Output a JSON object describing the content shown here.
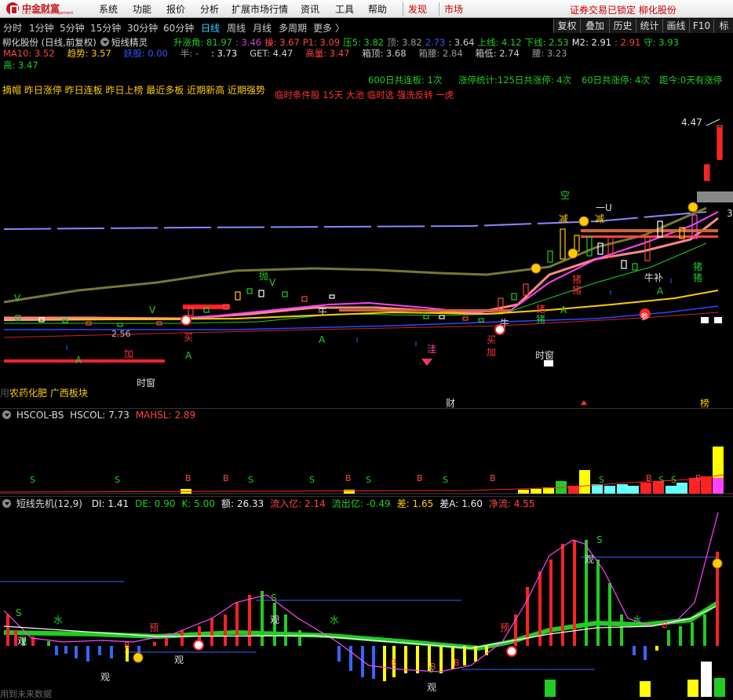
{
  "app": {
    "logo_cn": "中金财富",
    "logo_en": "CICC Wealth Management",
    "menu": [
      "系统",
      "功能",
      "报价",
      "分析",
      "扩展市场行情",
      "资讯",
      "工具",
      "帮助"
    ],
    "discover": "发现",
    "market": "市场",
    "lock_message": "证券交易已锁定  柳化股份"
  },
  "periods": {
    "items": [
      "分时",
      "1分钟",
      "5分钟",
      "15分钟",
      "30分钟",
      "60分钟",
      "日线",
      "周线",
      "月线",
      "多周期",
      "更多 〉"
    ],
    "active": "日线",
    "right_tabs": [
      "复权",
      "叠加",
      "历史",
      "统计",
      "画线",
      "F10",
      "标"
    ]
  },
  "main_panel": {
    "stock_title": "柳化股份 (日线,前复权)",
    "indicator_name": "短线精灵",
    "row1": [
      {
        "text": "升涨角: 81.97",
        "color": "#22cc22"
      },
      {
        "text": ": 3.46",
        "color": "#cc44cc"
      },
      {
        "text": "操: 3.67",
        "color": "#ff4444"
      },
      {
        "text": "P1: 3.09",
        "color": "#ff4444"
      },
      {
        "text": "压5: 3.82",
        "color": "#22cc22"
      },
      {
        "text": "顶: 3.82",
        "color": "#999999"
      },
      {
        "text": "2.73",
        "color": "#3355ff"
      },
      {
        "text": ": 3.64",
        "color": "#cccccc"
      },
      {
        "text": "上线: 4.12",
        "color": "#22cc22"
      },
      {
        "text": "下线: 2.53",
        "color": "#22cc22"
      },
      {
        "text": "M2: 2.91",
        "color": "#eeeeee"
      },
      {
        "text": ": 2.91",
        "color": "#ff4444"
      },
      {
        "text": "守: 3.93",
        "color": "#22cc22"
      }
    ],
    "row2": [
      {
        "text": "MA10: 3.52",
        "color": "#ff4444"
      },
      {
        "text": "趋势: 3.57",
        "color": "#ffcc00"
      },
      {
        "text": "妖股: 0.00",
        "color": "#3355ff"
      },
      {
        "text": "半: -",
        "color": "#999999"
      },
      {
        "text": ": 3.73",
        "color": "#eeeeee"
      },
      {
        "text": "GET: 4.47",
        "color": "#cccccc"
      },
      {
        "text": "高量: 3.47",
        "color": "#ff4444"
      },
      {
        "text": "箱顶: 3.68",
        "color": "#cccccc"
      },
      {
        "text": "箱腰: 2.84",
        "color": "#999999"
      },
      {
        "text": "箱低: 2.74",
        "color": "#cccccc"
      },
      {
        "text": "腰: 3.23",
        "color": "#999999"
      }
    ],
    "row3": {
      "text": "高: 3.47",
      "color": "#22cc22"
    },
    "tags_line": "摘帽 昨日涨停 昨日连板 昨日上榜 最近多板 近期新高 近期强势",
    "stats": [
      "600日共连板: 1次",
      "涨停统计:125日共涨停: 4次",
      "60日共涨停: 4次",
      "距今:0天有涨停"
    ],
    "condition_line": "临时条件股 15天 大池 临时选 强洗反转 一虎",
    "price_high_label": "4.47",
    "price_low_label": "2.56",
    "right_price_cut": "3",
    "sector": "农药化肥 广西板块",
    "sector_prefix": "用",
    "chart_marks": {
      "buy": "买",
      "add": "加",
      "kong": "空",
      "jian": "减",
      "oneU": "一U",
      "zhu": "猪",
      "niu": "牛",
      "niubu": "牛补",
      "shichuang": "时窗",
      "wa": "洼",
      "A": "A",
      "V": "V",
      "cai": "财",
      "bang": "榜",
      "plus": "+",
      "pao": "抛",
      "can": "参"
    }
  },
  "hscol_panel": {
    "title": "HSCOL-BS",
    "hscol": "HSCOL: 7.73",
    "mahsl": "MAHSL: 2.89",
    "S": "S",
    "B": "B"
  },
  "short_panel": {
    "title": "短线先机(12,9)",
    "values": [
      {
        "text": "DI: 1.41",
        "color": "#eeeeee"
      },
      {
        "text": "DE: 0.90",
        "color": "#22cc22"
      },
      {
        "text": "K: 5.00",
        "color": "#22cc22"
      },
      {
        "text": "额: 26.33",
        "color": "#eeeeee"
      },
      {
        "text": "流入亿: 2.14",
        "color": "#ff4444"
      },
      {
        "text": "流出亿: -0.49",
        "color": "#22cc22"
      },
      {
        "text": "差: 1.65",
        "color": "#ffcc00"
      },
      {
        "text": "差A: 1.60",
        "color": "#eeeeee"
      },
      {
        "text": "净流: 4.55",
        "color": "#ff4444"
      }
    ],
    "marks": {
      "S": "S",
      "shui": "水",
      "guan": "观",
      "yu": "预",
      "B": "B"
    },
    "footer": "用到未来数据"
  }
}
